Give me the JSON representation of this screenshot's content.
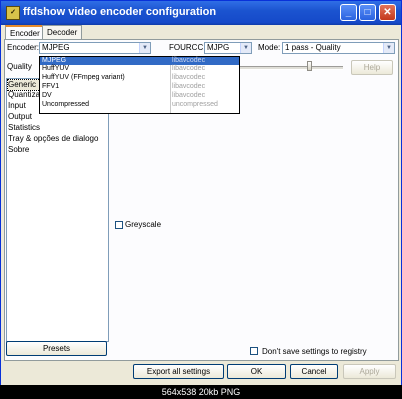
{
  "window": {
    "title": "ffdshow video encoder configuration",
    "app_icon": "ffdshow-icon",
    "controls": {
      "minimize": "_",
      "maximize": "□",
      "close": "✕"
    }
  },
  "tabs": [
    {
      "label": "Encoder",
      "active": true
    },
    {
      "label": "Decoder",
      "active": false
    }
  ],
  "encoder": {
    "label": "Encoder:",
    "value": "MJPEG",
    "options": [
      {
        "name": "MJPEG",
        "lib": "libavcodec"
      },
      {
        "name": "HuffYUV",
        "lib": "libavcodec"
      },
      {
        "name": "HuffYUV (FFmpeg variant)",
        "lib": "libavcodec"
      },
      {
        "name": "FFV1",
        "lib": "libavcodec"
      },
      {
        "name": "DV",
        "lib": "libavcodec"
      },
      {
        "name": "Uncompressed",
        "lib": "uncompressed"
      }
    ]
  },
  "fourcc": {
    "label": "FOURCC:",
    "value": "MJPG"
  },
  "mode": {
    "label": "Mode:",
    "value": "1 pass - Quality"
  },
  "quality": {
    "label": "Quality",
    "help": "Help",
    "level": 0.68
  },
  "sidebar": {
    "items": [
      {
        "label": "Generic",
        "selected": true
      },
      {
        "label": "Quantization"
      },
      {
        "label": "Input"
      },
      {
        "label": "Output"
      },
      {
        "label": "Statistics"
      },
      {
        "label": "Tray & opções de dialogo"
      },
      {
        "label": "Sobre"
      }
    ],
    "presets": "Presets"
  },
  "greyscale": {
    "label": "Greyscale",
    "checked": false
  },
  "dont_save": {
    "label": "Don't save settings to registry",
    "checked": false
  },
  "footer": {
    "export": "Export all settings",
    "ok": "OK",
    "cancel": "Cancel",
    "apply": "Apply"
  },
  "statusbar": "564x538 20kb PNG"
}
